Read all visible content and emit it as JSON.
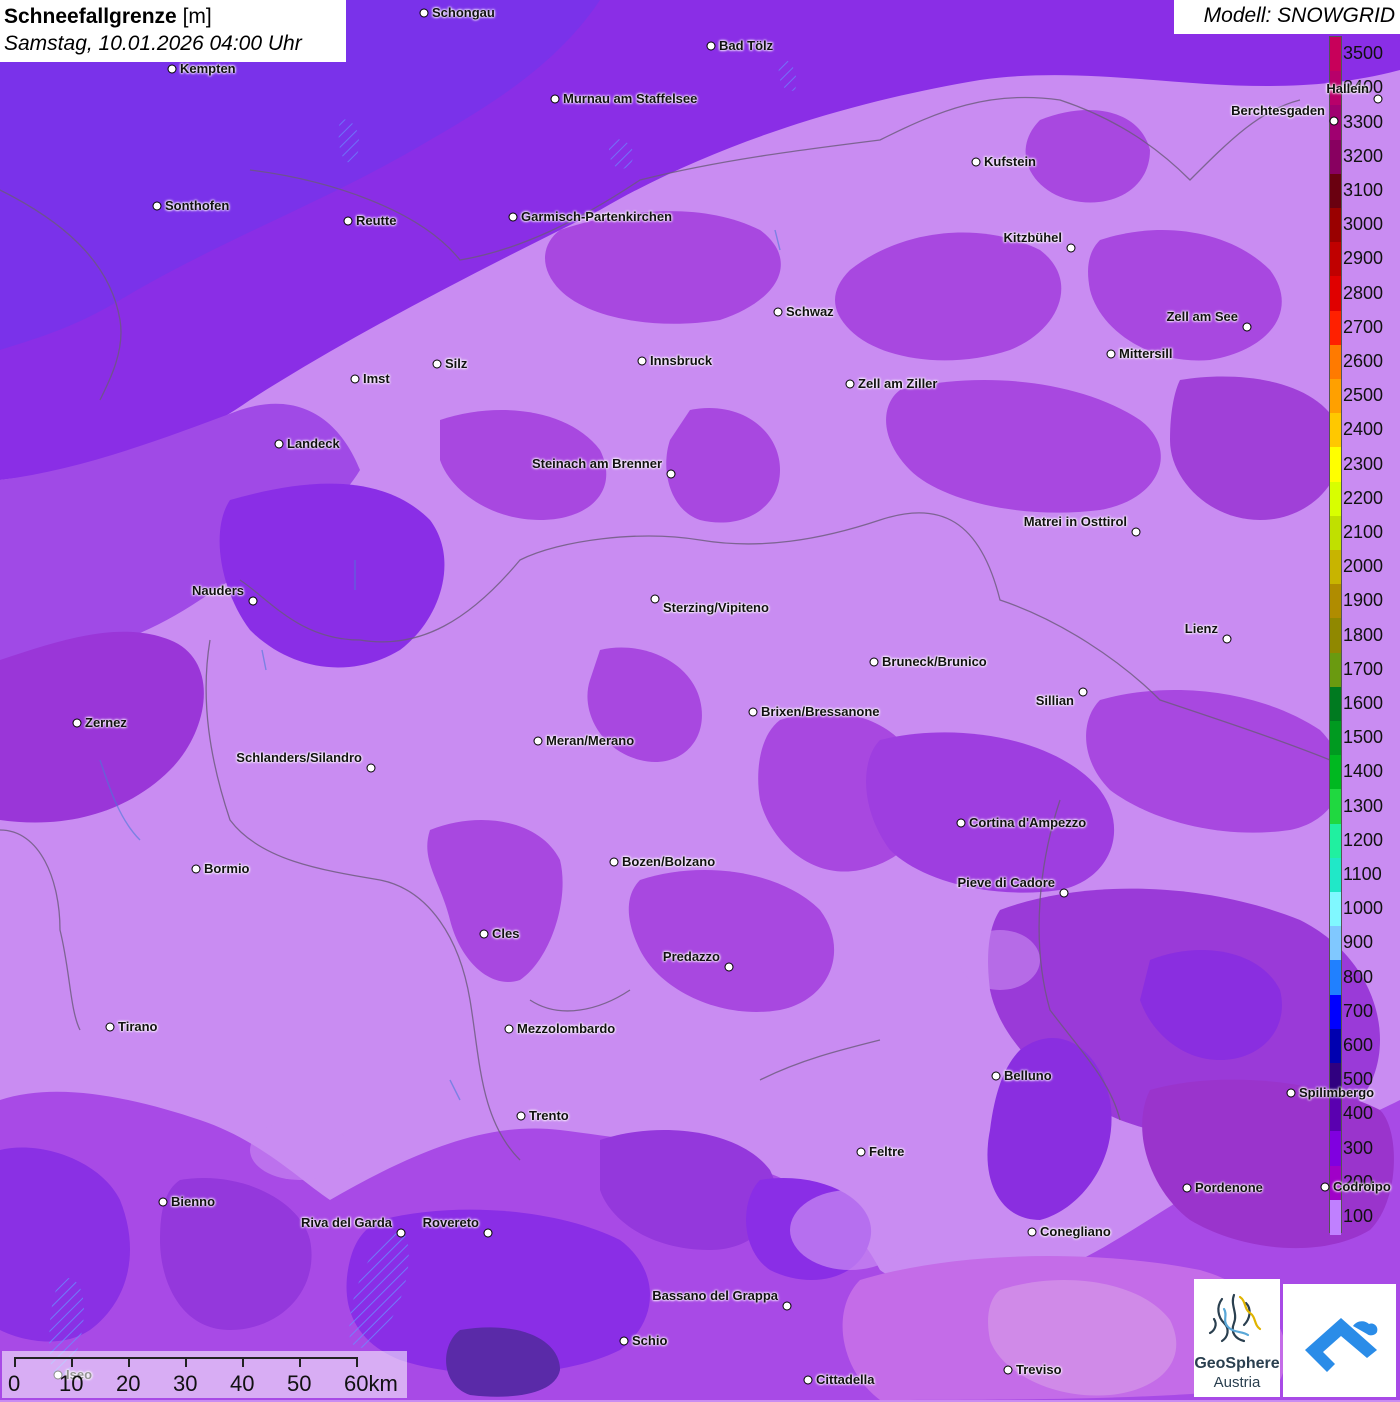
{
  "header": {
    "title": "Schneefallgrenze",
    "unit": "[m]",
    "datetime": "Samstag, 10.01.2026 04:00 Uhr",
    "model": "Modell: SNOWGRID"
  },
  "legend": {
    "title": "Schneefallgrenze [m]",
    "levels": [
      {
        "label": "3500",
        "color": "#c8005a"
      },
      {
        "label": "3400",
        "color": "#b8006a"
      },
      {
        "label": "3300",
        "color": "#a00070"
      },
      {
        "label": "3200",
        "color": "#880060"
      },
      {
        "label": "3100",
        "color": "#6a0010"
      },
      {
        "label": "3000",
        "color": "#9a0000"
      },
      {
        "label": "2900",
        "color": "#c00000"
      },
      {
        "label": "2800",
        "color": "#e00000"
      },
      {
        "label": "2700",
        "color": "#ff2000"
      },
      {
        "label": "2600",
        "color": "#ff7a00"
      },
      {
        "label": "2500",
        "color": "#ffa000"
      },
      {
        "label": "2400",
        "color": "#ffc800"
      },
      {
        "label": "2300",
        "color": "#ffff00"
      },
      {
        "label": "2200",
        "color": "#d8ff00"
      },
      {
        "label": "2100",
        "color": "#c0e000"
      },
      {
        "label": "2000",
        "color": "#c8b400"
      },
      {
        "label": "1900",
        "color": "#b08c00"
      },
      {
        "label": "1800",
        "color": "#908800"
      },
      {
        "label": "1700",
        "color": "#6a9a10"
      },
      {
        "label": "1600",
        "color": "#007a20"
      },
      {
        "label": "1500",
        "color": "#009a20"
      },
      {
        "label": "1400",
        "color": "#00b820"
      },
      {
        "label": "1300",
        "color": "#20d840"
      },
      {
        "label": "1200",
        "color": "#20f0a0"
      },
      {
        "label": "1100",
        "color": "#20e8c8"
      },
      {
        "label": "1000",
        "color": "#80f8ff"
      },
      {
        "label": "900",
        "color": "#80c8ff"
      },
      {
        "label": "800",
        "color": "#2080ff"
      },
      {
        "label": "700",
        "color": "#0000ff"
      },
      {
        "label": "600",
        "color": "#0000b0"
      },
      {
        "label": "500",
        "color": "#300080"
      },
      {
        "label": "400",
        "color": "#5a00b0"
      },
      {
        "label": "300",
        "color": "#8000e0"
      },
      {
        "label": "200",
        "color": "#a000c8"
      },
      {
        "label": "100",
        "color": "#c080ff"
      }
    ]
  },
  "cities": [
    {
      "name": "Schongau"
    },
    {
      "name": "Bad Tölz"
    },
    {
      "name": "Kempten"
    },
    {
      "name": "Murnau am Staffelsee"
    },
    {
      "name": "Hallein"
    },
    {
      "name": "Berchtesgaden"
    },
    {
      "name": "Kufstein"
    },
    {
      "name": "Sonthofen"
    },
    {
      "name": "Reutte"
    },
    {
      "name": "Garmisch-Partenkirchen"
    },
    {
      "name": "Kitzbühel"
    },
    {
      "name": "Schwaz"
    },
    {
      "name": "Zell am See"
    },
    {
      "name": "Mittersill"
    },
    {
      "name": "Innsbruck"
    },
    {
      "name": "Silz"
    },
    {
      "name": "Imst"
    },
    {
      "name": "Zell am Ziller"
    },
    {
      "name": "Landeck"
    },
    {
      "name": "Steinach am Brenner"
    },
    {
      "name": "Matrei in Osttirol"
    },
    {
      "name": "Nauders"
    },
    {
      "name": "Sterzing/Vipiteno"
    },
    {
      "name": "Lienz"
    },
    {
      "name": "Bruneck/Brunico"
    },
    {
      "name": "Sillian"
    },
    {
      "name": "Zernez"
    },
    {
      "name": "Brixen/Bressanone"
    },
    {
      "name": "Meran/Merano"
    },
    {
      "name": "Schlanders/Silandro"
    },
    {
      "name": "Cortina d'Ampezzo"
    },
    {
      "name": "Bormio"
    },
    {
      "name": "Bozen/Bolzano"
    },
    {
      "name": "Pieve di Cadore"
    },
    {
      "name": "Cles"
    },
    {
      "name": "Predazzo"
    },
    {
      "name": "Tirano"
    },
    {
      "name": "Mezzolombardo"
    },
    {
      "name": "Belluno"
    },
    {
      "name": "Spilimbergo"
    },
    {
      "name": "Trento"
    },
    {
      "name": "Feltre"
    },
    {
      "name": "Pordenone"
    },
    {
      "name": "Codroipo"
    },
    {
      "name": "Bienno"
    },
    {
      "name": "Riva del Garda"
    },
    {
      "name": "Rovereto"
    },
    {
      "name": "Conegliano"
    },
    {
      "name": "Bassano del Grappa"
    },
    {
      "name": "Schio"
    },
    {
      "name": "Treviso"
    },
    {
      "name": "Cittadella"
    },
    {
      "name": "Iseo"
    }
  ],
  "scale_bar": {
    "labels": [
      "0",
      "10",
      "20",
      "30",
      "40",
      "50",
      "60km"
    ]
  },
  "logos": {
    "geosphere_line1": "GeoSphere",
    "geosphere_line2": "Austria",
    "app_icon": "mountain-app-icon"
  },
  "colors": {
    "base_light": "#c98cf2",
    "mid": "#a84ee8",
    "dark": "#8b2fe0",
    "magenta": "#a032c8",
    "deep": "#7a2ad8"
  }
}
